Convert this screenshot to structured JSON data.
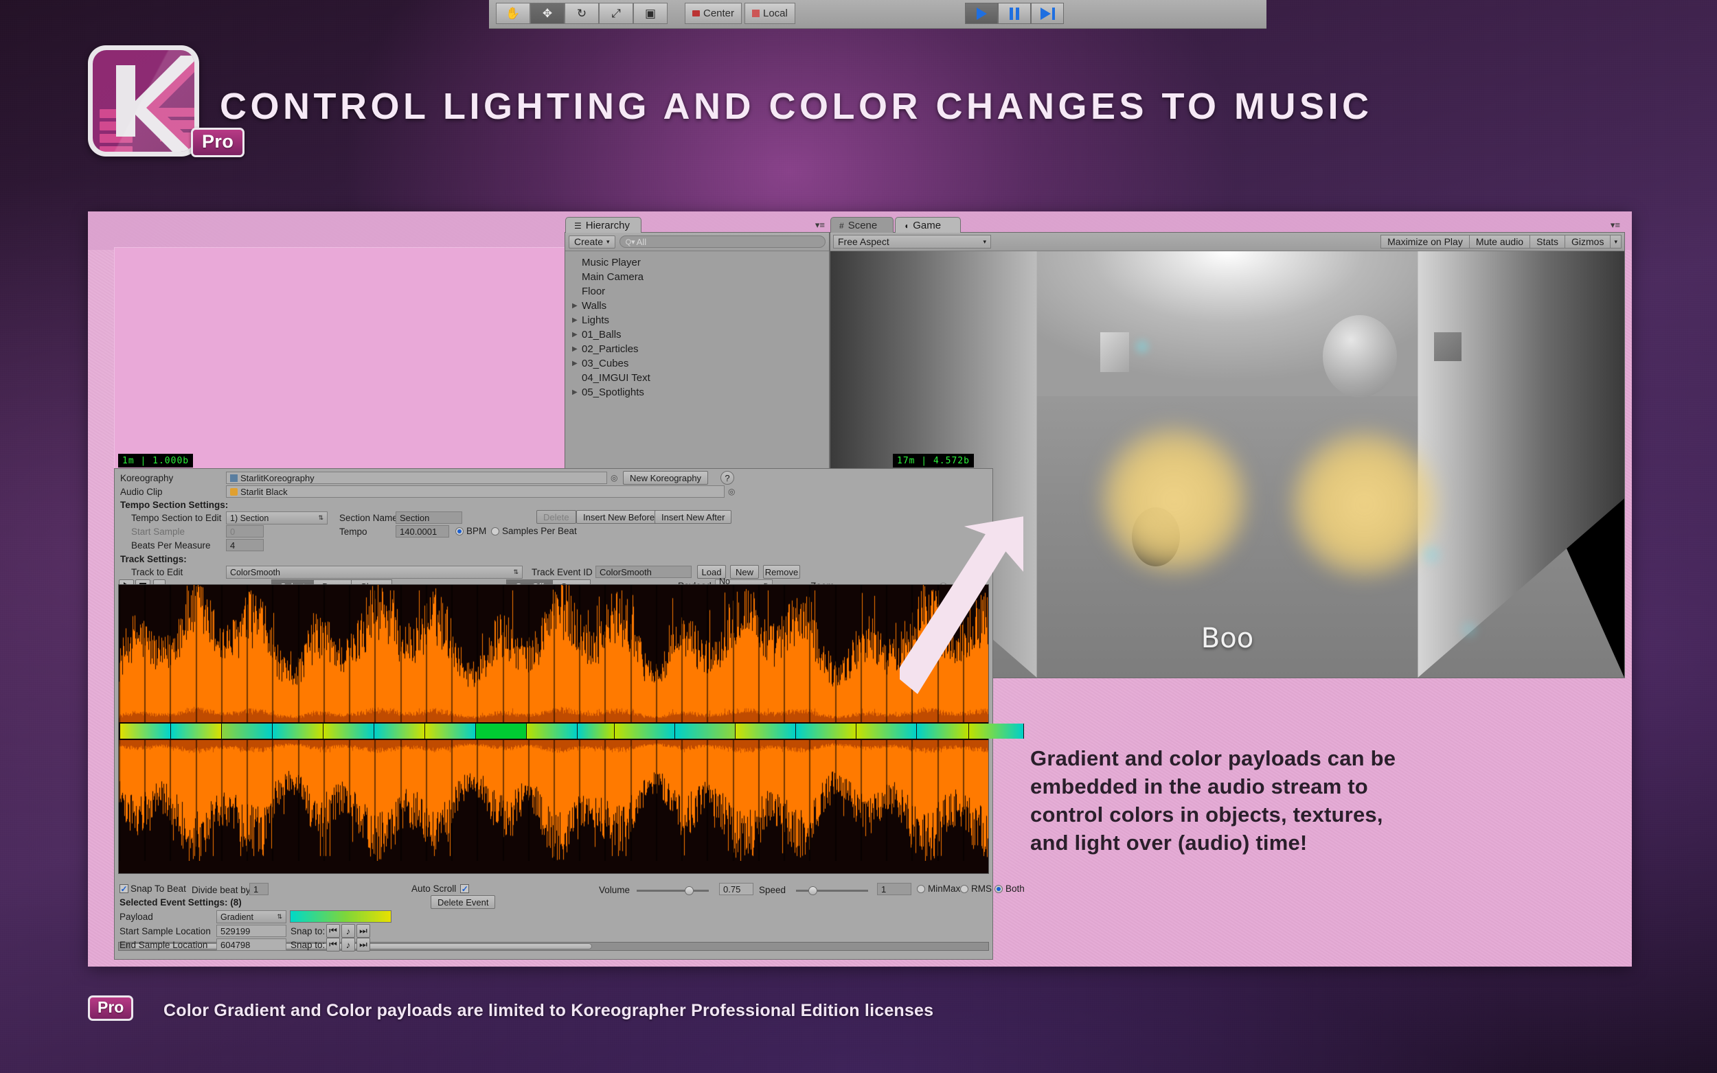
{
  "header": {
    "title": "CONTROL LIGHTING AND COLOR CHANGES TO MUSIC",
    "logo_badge": "Pro"
  },
  "unity": {
    "toolbar": {
      "tools": [
        "hand-icon",
        "move-icon",
        "rotate-icon",
        "scale-icon",
        "rect-icon"
      ],
      "pivot_label": "Center",
      "space_label": "Local",
      "play_icons": [
        "play-icon",
        "pause-icon",
        "step-icon"
      ]
    },
    "hierarchy": {
      "tab_label": "Hierarchy",
      "create_label": "Create",
      "search_placeholder": "All",
      "items": [
        {
          "label": "Music Player",
          "expandable": false
        },
        {
          "label": "Main Camera",
          "expandable": false
        },
        {
          "label": "Floor",
          "expandable": false
        },
        {
          "label": "Walls",
          "expandable": true
        },
        {
          "label": "Lights",
          "expandable": true
        },
        {
          "label": "01_Balls",
          "expandable": true
        },
        {
          "label": "02_Particles",
          "expandable": true
        },
        {
          "label": "03_Cubes",
          "expandable": true
        },
        {
          "label": "04_IMGUI Text",
          "expandable": false
        },
        {
          "label": "05_Spotlights",
          "expandable": true
        }
      ]
    },
    "scene_tab": "Scene",
    "game_tab": "Game",
    "game_toolbar": {
      "aspect": "Free Aspect",
      "maximize": "Maximize on Play",
      "mute": "Mute audio",
      "stats": "Stats",
      "gizmos": "Gizmos"
    },
    "game_view": {
      "overlay_text": "Boo"
    }
  },
  "koreographer": {
    "koreography_label": "Koreography",
    "koreography_value": "StarlitKoreography",
    "new_koreography_btn": "New Koreography",
    "help_btn": "?",
    "audio_clip_label": "Audio Clip",
    "audio_clip_value": "Starlit Black",
    "tempo_section_header": "Tempo Section Settings:",
    "tempo_section_to_edit_label": "Tempo Section to Edit",
    "tempo_section_to_edit_value": "1) Section",
    "section_name_label": "Section Name",
    "section_name_value": "Section",
    "start_sample_label": "Start Sample",
    "start_sample_value": "0",
    "tempo_label": "Tempo",
    "tempo_value": "140.0001",
    "bpm_label": "BPM",
    "samples_per_beat_label": "Samples Per Beat",
    "beats_per_measure_label": "Beats Per Measure",
    "beats_per_measure_value": "4",
    "delete_btn": "Delete",
    "insert_before_btn": "Insert New Before",
    "insert_after_btn": "Insert New After",
    "track_settings_header": "Track Settings:",
    "track_to_edit_label": "Track to Edit",
    "track_to_edit_value": "ColorSmooth",
    "track_event_id_label": "Track Event ID",
    "track_event_id_value": "ColorSmooth",
    "load_btn": "Load",
    "new_btn": "New",
    "remove_btn": "Remove",
    "edit_modes": [
      "Select",
      "Draw",
      "Clone"
    ],
    "edit_mode_selected": "Select",
    "event_types": [
      "OneOff",
      "Span"
    ],
    "event_type_selected": "OneOff",
    "payload_label": "Payload",
    "payload_filter_value": "No Payload",
    "zoom_label": "Zoom",
    "transport_icons": [
      "play-icon",
      "stop-icon",
      "dropdown-icon"
    ],
    "timecode_left": "1m | 1.000b",
    "timecode_right": "17m | 4.572b",
    "snap_to_beat_label": "Snap To Beat",
    "snap_to_beat_checked": true,
    "divide_beat_by_label": "Divide beat by",
    "divide_beat_by_value": "1",
    "auto_scroll_label": "Auto Scroll",
    "auto_scroll_checked": true,
    "volume_label": "Volume",
    "volume_value": "0.75",
    "speed_label": "Speed",
    "speed_value": "1",
    "display_modes": [
      "MinMax",
      "RMS",
      "Both"
    ],
    "display_mode_selected": "Both",
    "selected_event_header": "Selected Event Settings: (8)",
    "delete_event_btn": "Delete Event",
    "payload_row_label": "Payload",
    "payload_type_value": "Gradient",
    "start_sample_location_label": "Start Sample Location",
    "start_sample_location_value": "529199",
    "end_sample_location_label": "End Sample Location",
    "end_sample_location_value": "604798",
    "snap_to_label": "Snap to:",
    "gradient_stops": [
      "#00d8c8",
      "#7ed63a",
      "#e8e000"
    ]
  },
  "caption": {
    "lines": [
      "Gradient and color payloads can be",
      "embedded in the audio stream to",
      "control colors in objects, textures,",
      "and light over (audio) time!"
    ]
  },
  "footer": {
    "badge": "Pro",
    "text": "Color Gradient and Color payloads are limited to Koreographer Professional Edition licenses"
  },
  "colors": {
    "brand_magenta": "#8e2a72",
    "brand_pink": "#d1498f",
    "slide_bg": "#e4a9d4",
    "waveform_orange": "#ff7a00",
    "timecode_green": "#2bf23a"
  }
}
